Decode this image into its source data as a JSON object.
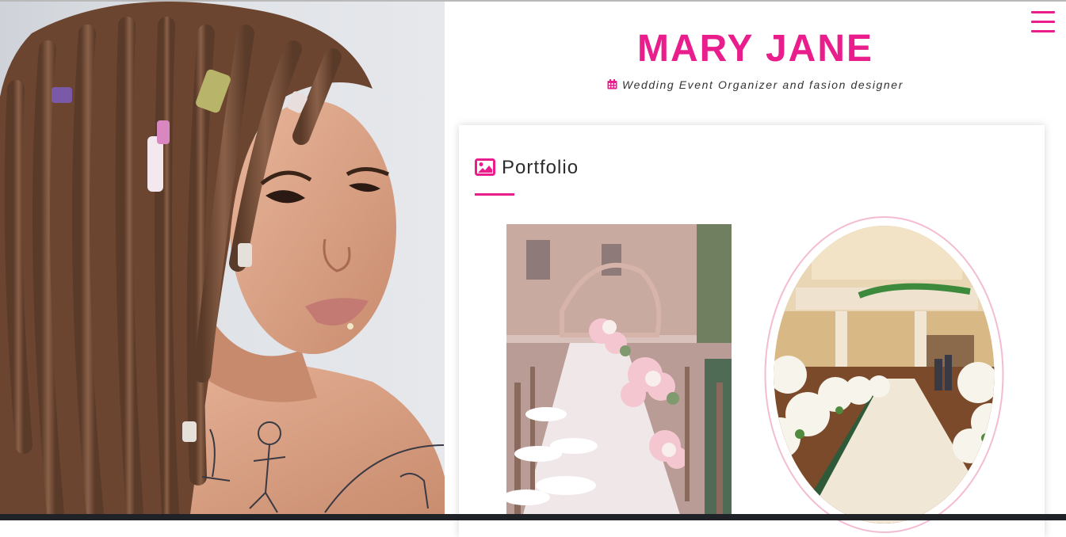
{
  "header": {
    "name": "MARY JANE",
    "subtitle": "Wedding Event Organizer and fasion designer",
    "subtitle_icon": "calendar-icon",
    "menu_icon": "hamburger-menu-icon"
  },
  "portfolio": {
    "title": "Portfolio",
    "title_icon": "image-icon",
    "images": [
      {
        "alt": "wedding table setting with flowers",
        "shape": "rectangle"
      },
      {
        "alt": "church aisle with white flower decorations",
        "shape": "oval"
      }
    ]
  },
  "colors": {
    "accent": "#e91e8c",
    "text": "#333333",
    "oval_border": "#f4bcd3"
  }
}
